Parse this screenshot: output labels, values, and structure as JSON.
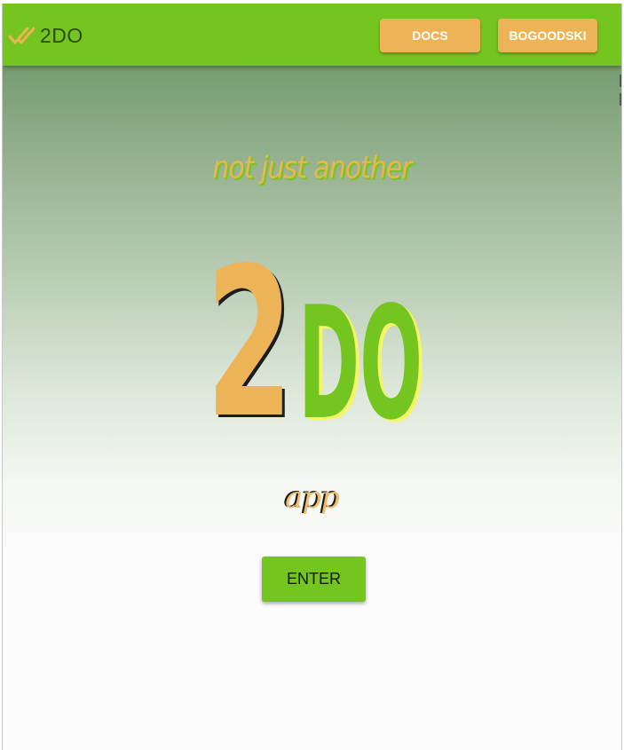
{
  "header": {
    "brand": "2DO",
    "docs_label": "DOCS",
    "user_label": "BOGOODSKI"
  },
  "hero": {
    "tagline": "not just another",
    "logo_number": "2",
    "logo_letters": "DO",
    "subtitle": "app",
    "enter_label": "ENTER"
  },
  "colors": {
    "appbar": "#74c51f",
    "accent_orange": "#ecb457",
    "brand_text": "#2c4d12",
    "logo_yellow_shadow": "#f5f56a"
  },
  "icons": {
    "brand_icon": "double-check-icon"
  }
}
